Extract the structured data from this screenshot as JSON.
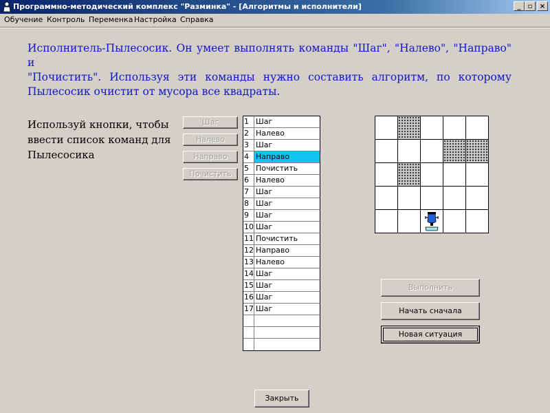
{
  "window": {
    "title": "Программно-методический комплекс \"Разминка\" - [Алгоритмы и исполнители]",
    "controls": {
      "minimize": "_",
      "restore": "▫",
      "close": "×"
    }
  },
  "menu": [
    "Обучение",
    "Контроль",
    "Переменка",
    "Настройка",
    "Справка"
  ],
  "instruction_lines": [
    "Исполнитель-Пылесосик. Он умеет выполнять команды \"Шаг\", \"Налево\", \"Направо\" и",
    "\"Почистить\". Используя эти команды нужно составить алгоритм, по которому",
    "Пылесосик очистит от мусора все квадраты."
  ],
  "hint": "Используй кнопки, чтобы ввести список команд для Пылесосика",
  "command_buttons": [
    "Шаг",
    "Налево",
    "Направо",
    "Почистить"
  ],
  "commands": [
    {
      "n": "1",
      "cmd": "Шаг"
    },
    {
      "n": "2",
      "cmd": "Налево"
    },
    {
      "n": "3",
      "cmd": "Шаг"
    },
    {
      "n": "4",
      "cmd": "Направо"
    },
    {
      "n": "5",
      "cmd": "Почистить"
    },
    {
      "n": "6",
      "cmd": "Налево"
    },
    {
      "n": "7",
      "cmd": "Шаг"
    },
    {
      "n": "8",
      "cmd": "Шаг"
    },
    {
      "n": "9",
      "cmd": "Шаг"
    },
    {
      "n": "10",
      "cmd": "Шаг"
    },
    {
      "n": "11",
      "cmd": "Почистить"
    },
    {
      "n": "12",
      "cmd": "Направо"
    },
    {
      "n": "13",
      "cmd": "Налево"
    },
    {
      "n": "14",
      "cmd": "Шаг"
    },
    {
      "n": "15",
      "cmd": "Шаг"
    },
    {
      "n": "16",
      "cmd": "Шаг"
    },
    {
      "n": "17",
      "cmd": "Шаг"
    },
    {
      "n": "",
      "cmd": ""
    },
    {
      "n": "",
      "cmd": ""
    },
    {
      "n": "",
      "cmd": ""
    }
  ],
  "selected_command": 4,
  "grid": {
    "rows": 5,
    "cols": 5,
    "dirty_cells": [
      [
        0,
        1
      ],
      [
        1,
        3
      ],
      [
        1,
        4
      ],
      [
        2,
        1
      ]
    ],
    "robot_cell": [
      4,
      2
    ]
  },
  "actions": {
    "execute": "Выполнить",
    "restart": "Начать сначала",
    "new_situation": "Новая ситуация",
    "close": "Закрыть"
  },
  "colors": {
    "instruction_text": "#1414c8",
    "selected_row": "#13c3f0",
    "robot": "#1f5fd8"
  }
}
